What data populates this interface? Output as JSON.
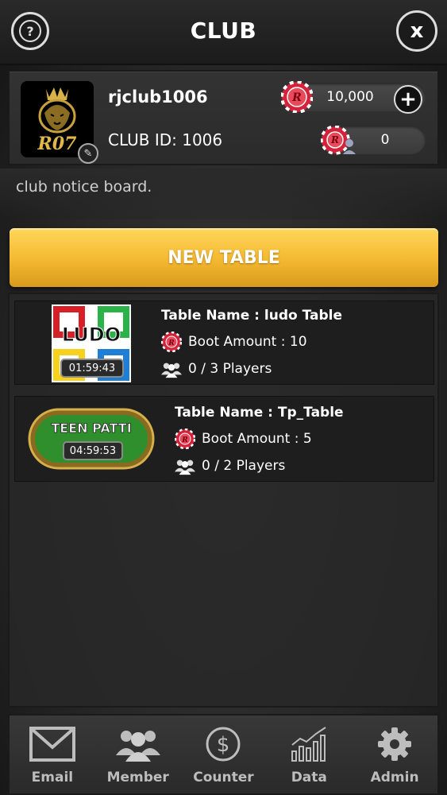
{
  "header": {
    "title": "CLUB",
    "help_icon": "question-icon",
    "close_icon": "close-icon",
    "help_glyph": "?",
    "close_glyph": "x"
  },
  "club": {
    "name": "rjclub1006",
    "id_label": "CLUB ID: 1006",
    "logo_text": "R07",
    "coin_balance": "10,000",
    "member_count": "0",
    "add_glyph": "+"
  },
  "notice": {
    "text": "club notice board."
  },
  "new_table": {
    "label": "NEW TABLE"
  },
  "tables": [
    {
      "game": "ludo",
      "name": "Table Name : ludo Table",
      "boot": "Boot Amount : 10",
      "players": "0 / 3 Players",
      "timer": "01:59:43",
      "badge": "LUDO"
    },
    {
      "game": "teen-patti",
      "name": "Table Name : Tp_Table",
      "boot": "Boot Amount : 5",
      "players": "0 / 2 Players",
      "timer": "04:59:53",
      "badge": "TEEN PATTI"
    }
  ],
  "nav": [
    {
      "label": "Email",
      "icon": "mail-icon"
    },
    {
      "label": "Member",
      "icon": "members-icon"
    },
    {
      "label": "Counter",
      "icon": "dollar-icon"
    },
    {
      "label": "Data",
      "icon": "chart-icon"
    },
    {
      "label": "Admin",
      "icon": "gear-icon"
    }
  ],
  "colors": {
    "accent_gold": "#f3b830",
    "chip_red": "#d3223a",
    "teen_patti_green": "#2e8f2c"
  }
}
